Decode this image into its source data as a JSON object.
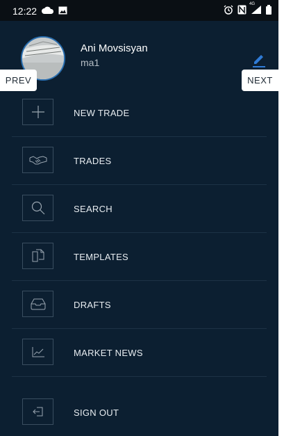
{
  "status_bar": {
    "time": "12:22",
    "icons": [
      "cloud-icon",
      "image-icon",
      "alarm-icon",
      "nfc-icon",
      "signal-4g-icon",
      "battery-icon"
    ],
    "network_label": "4G"
  },
  "profile": {
    "name": "Ani Movsisyan",
    "handle": "ma1",
    "edit_icon": "pencil-icon"
  },
  "navigation": {
    "prev_label": "PREV",
    "next_label": "NEXT"
  },
  "menu": {
    "items": [
      {
        "label": "NEW TRADE",
        "icon": "plus-icon"
      },
      {
        "label": "TRADES",
        "icon": "handshake-icon"
      },
      {
        "label": "SEARCH",
        "icon": "search-icon"
      },
      {
        "label": "TEMPLATES",
        "icon": "templates-icon"
      },
      {
        "label": "DRAFTS",
        "icon": "inbox-icon"
      },
      {
        "label": "MARKET NEWS",
        "icon": "chart-icon"
      }
    ],
    "sign_out": {
      "label": "SIGN OUT",
      "icon": "sign-out-icon"
    }
  },
  "colors": {
    "background": "#0c1f31",
    "accent": "#2a6fb0",
    "divider": "#1d3246",
    "text": "#e8edf1"
  }
}
